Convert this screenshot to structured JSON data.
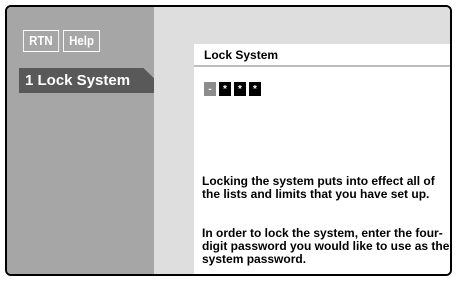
{
  "nav": {
    "rtn_label": "RTN",
    "help_label": "Help"
  },
  "menu": {
    "selected_item": "1 Lock System"
  },
  "panel": {
    "title": "Lock System",
    "password_cells": [
      "-",
      "*",
      "*",
      "*"
    ],
    "paragraph1": "Locking the system puts into effect all of the lists and limits that you have set up.",
    "paragraph2": "In order to lock the system, enter the four-digit password you would like to use as the system password."
  },
  "colors": {
    "left_panel": "#a6a6a6",
    "right_panel": "#dedede",
    "menu_highlight": "#595959"
  }
}
